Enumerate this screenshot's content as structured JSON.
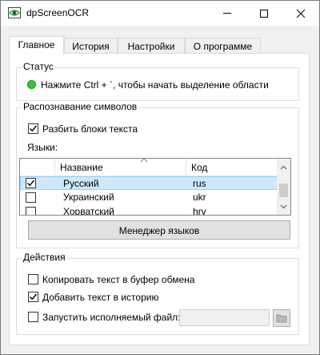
{
  "window": {
    "title": "dpScreenOCR"
  },
  "tabs": [
    {
      "label": "Главное",
      "active": true
    },
    {
      "label": "История",
      "active": false
    },
    {
      "label": "Настройки",
      "active": false
    },
    {
      "label": "О программе",
      "active": false
    }
  ],
  "status": {
    "group_title": "Статус",
    "indicator_color": "#35c63b",
    "message": "Нажмите Ctrl + `, чтобы начать выделение области"
  },
  "recognition": {
    "group_title": "Распознавание символов",
    "split_blocks": {
      "label": "Разбить блоки текста",
      "checked": true
    },
    "languages_label": "Языки:",
    "table": {
      "columns": [
        "Название",
        "Код"
      ],
      "rows": [
        {
          "checked": true,
          "name": "Русский",
          "code": "rus",
          "selected": true
        },
        {
          "checked": false,
          "name": "Украинский",
          "code": "ukr",
          "selected": false
        },
        {
          "checked": false,
          "name": "Хорватский",
          "code": "hrv",
          "selected": false
        }
      ]
    },
    "manager_button": "Менеджер языков"
  },
  "actions": {
    "group_title": "Действия",
    "copy_to_clipboard": {
      "label": "Копировать текст в буфер обмена",
      "checked": false
    },
    "add_to_history": {
      "label": "Добавить текст в историю",
      "checked": true
    },
    "run_executable": {
      "label": "Запустить исполняемый файл:",
      "checked": false,
      "value": ""
    }
  }
}
